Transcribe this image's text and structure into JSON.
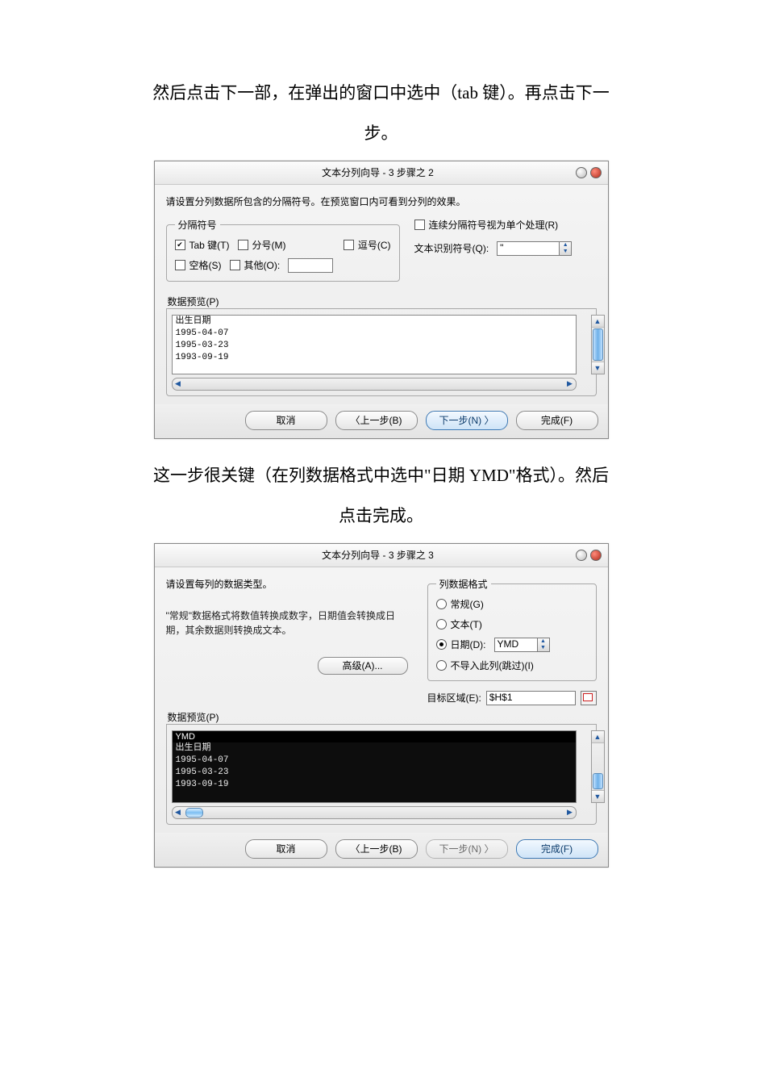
{
  "instruction1": "然后点击下一部，在弹出的窗口中选中（tab 键）。再点击下一步。",
  "instruction2": "这一步很关键（在列数据格式中选中\"日期 YMD\"格式）。然后点击完成。",
  "dialog2": {
    "title": "文本分列向导 - 3 步骤之 2",
    "prompt": "请设置分列数据所包含的分隔符号。在预览窗口内可看到分列的效果。",
    "delim_legend": "分隔符号",
    "tab_label": "Tab 键(T)",
    "semicolon_label": "分号(M)",
    "comma_label": "逗号(C)",
    "space_label": "空格(S)",
    "other_label": "其他(O):",
    "consecutive_label": "连续分隔符号视为单个处理(R)",
    "text_qualifier_label": "文本识别符号(Q):",
    "text_qualifier_value": "\"",
    "preview_legend": "数据预览(P)",
    "preview_rows": [
      "出生日期",
      "1995-04-07",
      "1995-03-23",
      "1993-09-19"
    ],
    "btn_cancel": "取消",
    "btn_back": "〈上一步(B)",
    "btn_next": "下一步(N) 〉",
    "btn_finish": "完成(F)"
  },
  "dialog3": {
    "title": "文本分列向导 - 3 步骤之 3",
    "prompt": "请设置每列的数据类型。",
    "hint": "\"常规\"数据格式将数值转换成数字，日期值会转换成日期，其余数据则转换成文本。",
    "advanced": "高级(A)...",
    "format_legend": "列数据格式",
    "opt_general": "常规(G)",
    "opt_text": "文本(T)",
    "opt_date": "日期(D):",
    "date_value": "YMD",
    "opt_skip": "不导入此列(跳过)(I)",
    "target_label": "目标区域(E):",
    "target_value": "$H$1",
    "preview_legend": "数据预览(P)",
    "preview_header": "YMD",
    "preview_rows": [
      "出生日期",
      "1995-04-07",
      "1995-03-23",
      "1993-09-19"
    ],
    "btn_cancel": "取消",
    "btn_back": "〈上一步(B)",
    "btn_next": "下一步(N) 〉",
    "btn_finish": "完成(F)"
  }
}
